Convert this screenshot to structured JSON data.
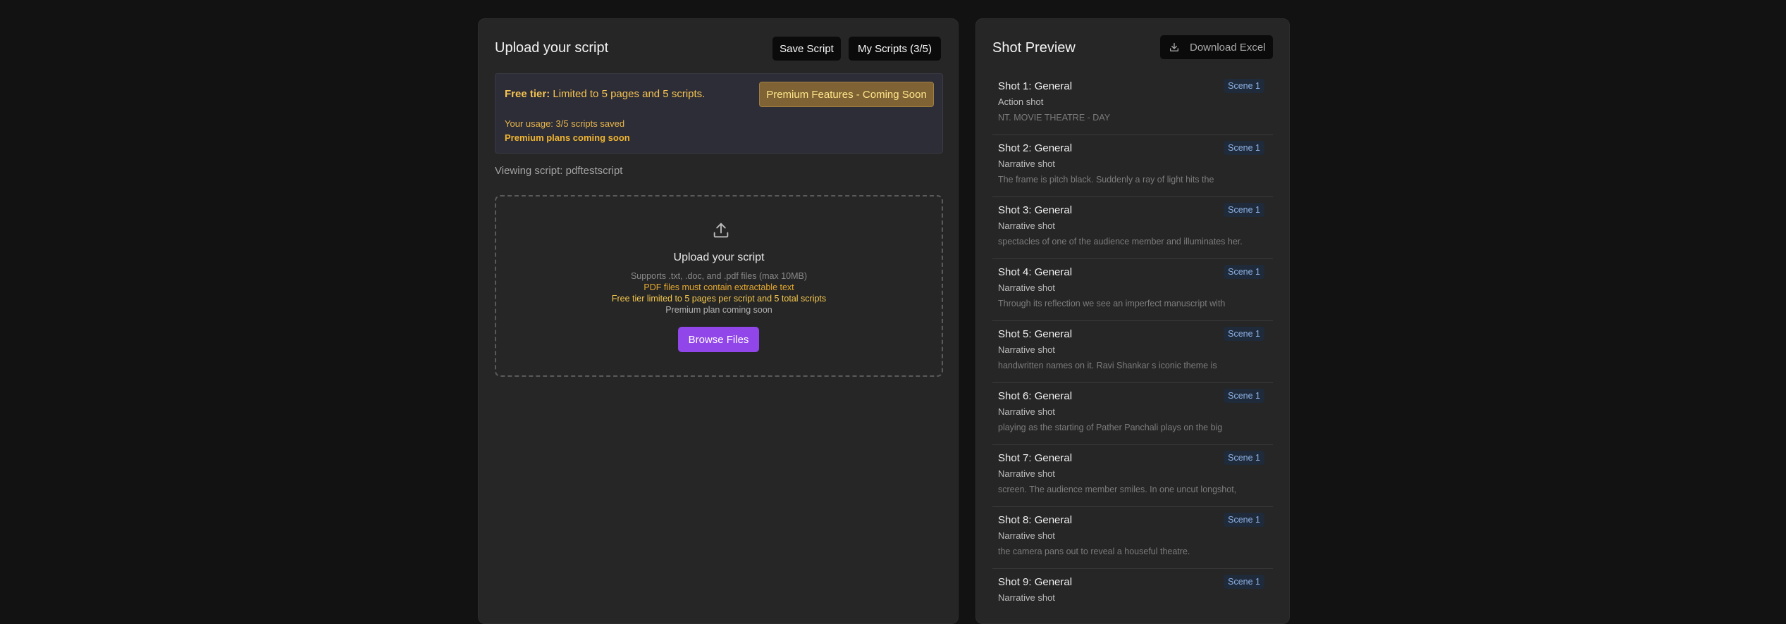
{
  "left": {
    "title": "Upload your script",
    "save_label": "Save Script",
    "my_scripts_label": "My Scripts (3/5)",
    "tier": {
      "label": "Free tier:",
      "text": " Limited to 5 pages and 5 scripts.",
      "premium_label": "Premium Features - Coming Soon",
      "usage": "Your usage: 3/5 scripts saved",
      "plans": "Premium plans coming soon"
    },
    "viewing": "Viewing script: pdftestscript",
    "dropzone": {
      "title": "Upload your script",
      "supports": "Supports .txt, .doc, and .pdf files (max 10MB)",
      "pdf_note": "PDF files must contain extractable text",
      "free_note": "Free tier limited to 5 pages per script and 5 total scripts",
      "premium_note": "Premium plan coming soon",
      "browse_label": "Browse Files"
    }
  },
  "right": {
    "title": "Shot Preview",
    "download_label": "Download Excel",
    "shots": [
      {
        "title": "Shot 1: General",
        "type": "Action shot",
        "desc": "NT. MOVIE THEATRE - DAY",
        "scene": "Scene 1"
      },
      {
        "title": "Shot 2: General",
        "type": "Narrative shot",
        "desc": "The frame is pitch black. Suddenly a ray of light hits the",
        "scene": "Scene 1"
      },
      {
        "title": "Shot 3: General",
        "type": "Narrative shot",
        "desc": "spectacles of one of the audience member and illuminates her.",
        "scene": "Scene 1"
      },
      {
        "title": "Shot 4: General",
        "type": "Narrative shot",
        "desc": "Through its reflection we see an imperfect manuscript with",
        "scene": "Scene 1"
      },
      {
        "title": "Shot 5: General",
        "type": "Narrative shot",
        "desc": "handwritten names on it. Ravi Shankar s iconic theme is",
        "scene": "Scene 1"
      },
      {
        "title": "Shot 6: General",
        "type": "Narrative shot",
        "desc": "playing as the starting of Pather Panchali plays on the big",
        "scene": "Scene 1"
      },
      {
        "title": "Shot 7: General",
        "type": "Narrative shot",
        "desc": "screen. The audience member smiles. In one uncut longshot,",
        "scene": "Scene 1"
      },
      {
        "title": "Shot 8: General",
        "type": "Narrative shot",
        "desc": "the camera pans out to reveal a houseful theatre.",
        "scene": "Scene 1"
      },
      {
        "title": "Shot 9: General",
        "type": "Narrative shot",
        "desc": "",
        "scene": "Scene 1"
      }
    ]
  },
  "colors": {
    "background": "#121212",
    "panel": "#262626",
    "accent_purple": "#9146ea",
    "warning_yellow": "#f5c350",
    "scene_badge": "#8fb4e8"
  }
}
